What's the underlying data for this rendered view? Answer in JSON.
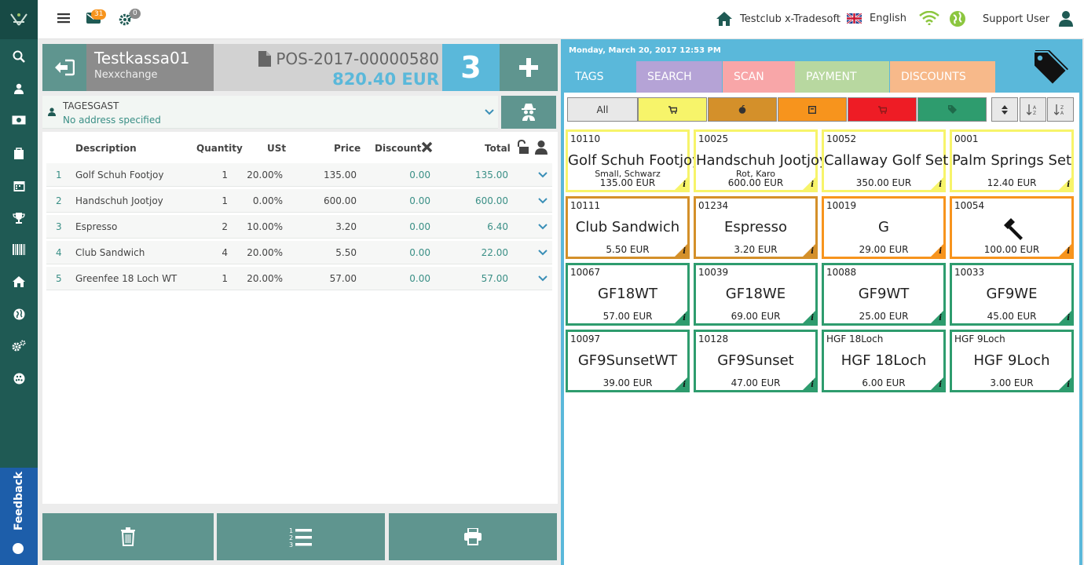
{
  "topbar": {
    "messages_count": "31",
    "settings_count": "0",
    "club": "Testclub x-Tradesoft",
    "language": "English",
    "user": "Support User"
  },
  "sidebar": {
    "icons": [
      "search-icon",
      "user-icon",
      "cash-icon",
      "bag-icon",
      "calendar-icon",
      "trophy-icon",
      "barcode-icon",
      "home-icon",
      "globe-icon",
      "settings-icon",
      "golf-ball-icon"
    ],
    "feedback_label": "Feedback"
  },
  "pos": {
    "register_name": "Testkassa01",
    "register_sub": "Nexxchange",
    "document_no": "POS-2017-00000580",
    "total": "820.40 EUR",
    "item_count": "3"
  },
  "customer": {
    "name": "TAGESGAST",
    "address": "No address specified"
  },
  "table": {
    "headers": {
      "description": "Description",
      "quantity": "Quantity",
      "vat": "USt",
      "price": "Price",
      "discount": "Discount",
      "total": "Total"
    },
    "rows": [
      {
        "no": "1",
        "description": "Golf Schuh Footjoy",
        "quantity": "1",
        "vat": "20.00%",
        "price": "135.00",
        "discount": "0.00",
        "total": "135.00"
      },
      {
        "no": "2",
        "description": "Handschuh Jootjoy",
        "quantity": "1",
        "vat": "0.00%",
        "price": "600.00",
        "discount": "0.00",
        "total": "600.00"
      },
      {
        "no": "3",
        "description": "Espresso",
        "quantity": "2",
        "vat": "10.00%",
        "price": "3.20",
        "discount": "0.00",
        "total": "6.40"
      },
      {
        "no": "4",
        "description": "Club Sandwich",
        "quantity": "4",
        "vat": "20.00%",
        "price": "5.50",
        "discount": "0.00",
        "total": "22.00"
      },
      {
        "no": "5",
        "description": "Greenfee 18 Loch WT",
        "quantity": "1",
        "vat": "20.00%",
        "price": "57.00",
        "discount": "0.00",
        "total": "57.00"
      }
    ]
  },
  "right": {
    "datetime": "Monday, March 20, 2017 12:53 PM",
    "tabs": [
      {
        "label": "TAGS",
        "color": "#5ab8da"
      },
      {
        "label": "SEARCH",
        "color": "#b5a3d6"
      },
      {
        "label": "SCAN",
        "color": "#f8a6a8"
      },
      {
        "label": "PAYMENT",
        "color": "#b8d8a0"
      },
      {
        "label": "DISCOUNTS",
        "color": "#f7b98a"
      }
    ],
    "filter_all": "All",
    "filters": [
      {
        "color": "#f7f46a",
        "icon": "cart-icon"
      },
      {
        "color": "#d4902a",
        "icon": "apple-icon"
      },
      {
        "color": "#f7941d",
        "icon": "box-icon"
      },
      {
        "color": "#ee1c25",
        "icon": "cart-icon"
      },
      {
        "color": "#2e9c6e",
        "icon": "tag-icon"
      }
    ],
    "products": [
      {
        "id": "10110",
        "name": "Golf Schuh Footjoy",
        "sub1": "Small, Schwarz",
        "sub2": "",
        "price": "135.00 EUR",
        "color": "#f7f46a"
      },
      {
        "id": "10025",
        "name": "Handschuh Jootjoy",
        "sub1": "Rot, Karo",
        "sub2": "",
        "price": "600.00 EUR",
        "color": "#f7f46a"
      },
      {
        "id": "10052",
        "name": "Callaway Golf Set",
        "sub1": "",
        "sub2": "",
        "price": "350.00 EUR",
        "color": "#f7f46a"
      },
      {
        "id": "0001",
        "name": "Palm Springs Set",
        "sub1": "",
        "sub2": "",
        "price": "12.40 EUR",
        "color": "#f7f46a"
      },
      {
        "id": "10111",
        "name": "Club Sandwich",
        "sub1": "",
        "sub2": "",
        "price": "5.50 EUR",
        "color": "#d4902a"
      },
      {
        "id": "01234",
        "name": "Espresso",
        "sub1": "",
        "sub2": "",
        "price": "3.20 EUR",
        "color": "#d4902a"
      },
      {
        "id": "10019",
        "name": "G",
        "sub1": "",
        "sub2": "",
        "price": "29.00 EUR",
        "color": "#f7941d"
      },
      {
        "id": "10054",
        "name": "",
        "sub1": "",
        "sub2": "",
        "price": "100.00 EUR",
        "color": "#f7941d",
        "icon": "hammer-icon"
      },
      {
        "id": "10067",
        "name": "GF18WT",
        "sub1": "",
        "sub2": "",
        "price": "57.00 EUR",
        "color": "#2e9c6e"
      },
      {
        "id": "10039",
        "name": "GF18WE",
        "sub1": "",
        "sub2": "",
        "price": "69.00 EUR",
        "color": "#2e9c6e"
      },
      {
        "id": "10088",
        "name": "GF9WT",
        "sub1": "",
        "sub2": "",
        "price": "25.00 EUR",
        "color": "#2e9c6e"
      },
      {
        "id": "10033",
        "name": "GF9WE",
        "sub1": "",
        "sub2": "",
        "price": "45.00 EUR",
        "color": "#2e9c6e"
      },
      {
        "id": "10097",
        "name": "GF9SunsetWT",
        "sub1": "",
        "sub2": "",
        "price": "39.00 EUR",
        "color": "#2e9c6e"
      },
      {
        "id": "10128",
        "name": "GF9Sunset",
        "sub1": "",
        "sub2": "",
        "price": "47.00 EUR",
        "color": "#2e9c6e"
      },
      {
        "id": "HGF 18Loch",
        "name": "HGF 18Loch",
        "sub1": "",
        "sub2": "",
        "price": "6.00 EUR",
        "color": "#2e9c6e"
      },
      {
        "id": "HGF 9Loch",
        "name": "HGF 9Loch",
        "sub1": "",
        "sub2": "",
        "price": "3.00 EUR",
        "color": "#2e9c6e"
      }
    ]
  }
}
